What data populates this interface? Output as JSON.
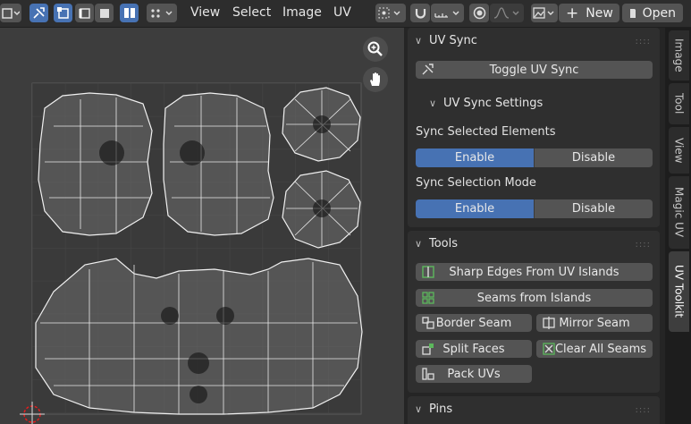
{
  "menus": [
    "View",
    "Select",
    "Image",
    "UV"
  ],
  "header_buttons": {
    "new_label": "New",
    "open_label": "Open"
  },
  "accent_color": "#4772b3",
  "sidebar": {
    "uv_sync": {
      "title": "UV Sync",
      "toggle_label": "Toggle UV Sync",
      "settings_title": "UV Sync Settings",
      "sync_selected_label": "Sync Selected Elements",
      "sync_mode_label": "Sync Selection Mode",
      "enable": "Enable",
      "disable": "Disable"
    },
    "tools": {
      "title": "Tools",
      "sharp_edges": "Sharp Edges From UV Islands",
      "seams_from_islands": "Seams from Islands",
      "border_seam": "Border Seam",
      "mirror_seam": "Mirror Seam",
      "split_faces": "Split Faces",
      "clear_all_seams": "Clear All Seams",
      "pack_uvs": "Pack UVs"
    },
    "pins": {
      "title": "Pins"
    }
  },
  "tabs": [
    "Image",
    "Tool",
    "View",
    "Magic UV",
    "UV Toolkit"
  ],
  "active_tab": "UV Toolkit"
}
